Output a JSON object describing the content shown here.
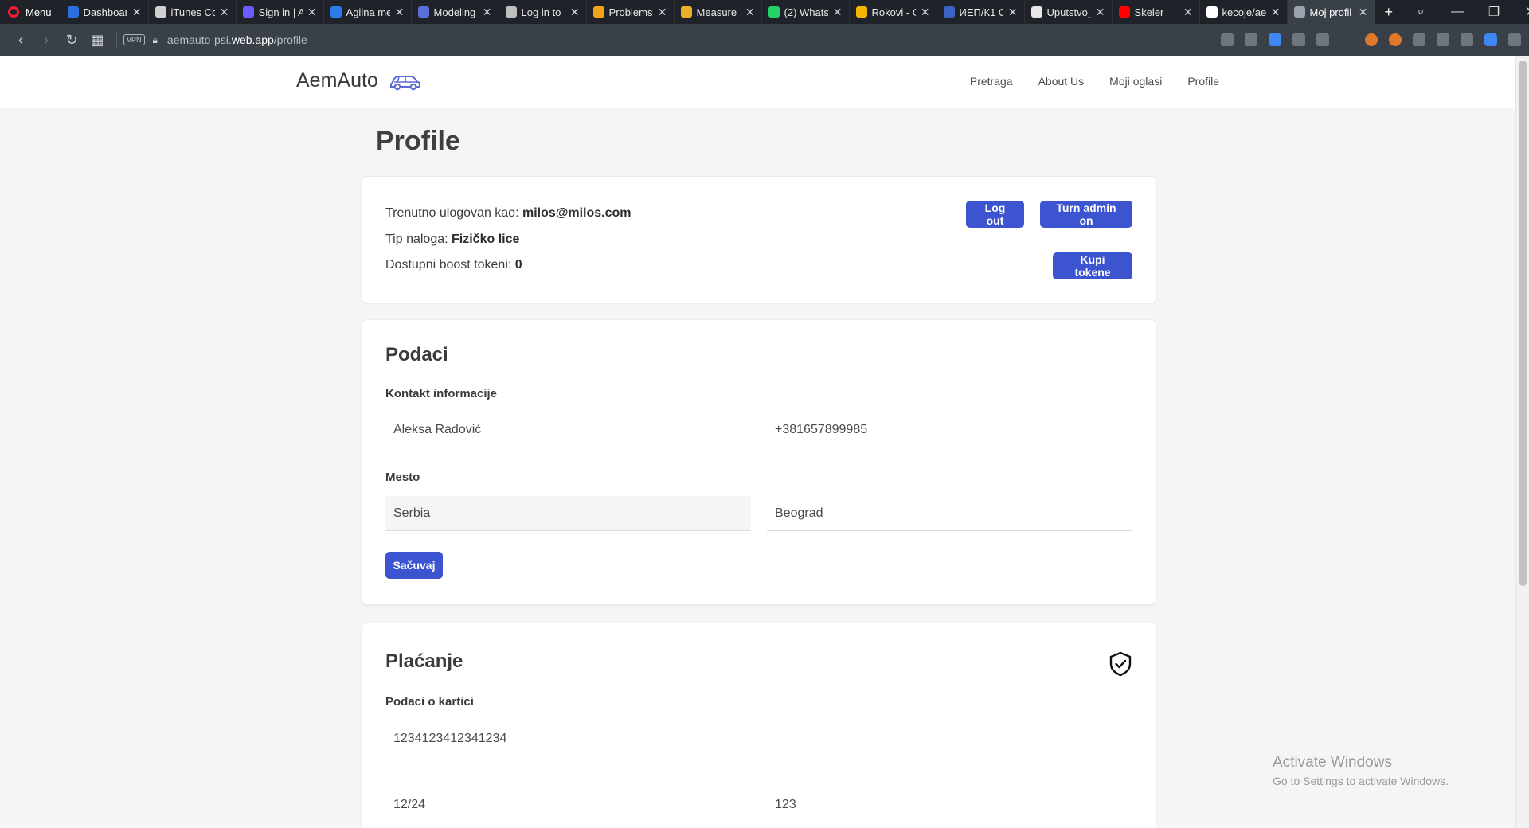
{
  "browser": {
    "menu_label": "Menu",
    "tabs": [
      {
        "title": "Dashboard",
        "color": "#2c6fe0"
      },
      {
        "title": "iTunes Co",
        "color": "#cfcfcf"
      },
      {
        "title": "Sign in | A",
        "color": "#6a5cff"
      },
      {
        "title": "Agilna me",
        "color": "#2b7de9"
      },
      {
        "title": "Modeling",
        "color": "#5b6fd6"
      },
      {
        "title": "Log in to",
        "color": "#bfbfbf"
      },
      {
        "title": "Problems",
        "color": "#f3a21a"
      },
      {
        "title": "Measure",
        "color": "#e9b026"
      },
      {
        "title": "(2) Whats",
        "color": "#25d366"
      },
      {
        "title": "Rokovi - G",
        "color": "#f5b400"
      },
      {
        "title": "ИЕП/К1 С",
        "color": "#3a62c7"
      },
      {
        "title": "Uputstvo_",
        "color": "#e8e8e8"
      },
      {
        "title": "Skeler",
        "color": "#ff0000"
      },
      {
        "title": "kecoje/ae",
        "color": "#ffffff"
      },
      {
        "title": "Moj profil",
        "color": "#9aa3ad"
      }
    ],
    "url_prefix": "aemauto-psi.",
    "url_domain": "web.app",
    "url_path": "/profile",
    "vpn_label": "VPN"
  },
  "navbar": {
    "brand": "AemAuto",
    "links": [
      "Pretraga",
      "About Us",
      "Moji oglasi",
      "Profile"
    ]
  },
  "page_title": "Profile",
  "account": {
    "logged_in_label": "Trenutno ulogovan kao: ",
    "email": "milos@milos.com",
    "account_type_label": "Tip naloga: ",
    "account_type": "Fizičko lice",
    "tokens_label": "Dostupni boost tokeni: ",
    "tokens": "0",
    "logout_button": "Log out",
    "admin_button": "Turn admin on",
    "buy_tokens_button": "Kupi tokene"
  },
  "podaci": {
    "title": "Podaci",
    "contact_label": "Kontakt informacije",
    "name": "Aleksa Radović",
    "phone": "+381657899985",
    "place_label": "Mesto",
    "country": "Serbia",
    "city": "Beograd",
    "save_button": "Sačuvaj"
  },
  "placanje": {
    "title": "Plaćanje",
    "card_label": "Podaci o kartici",
    "card_number": "1234123412341234",
    "expiry": "12/24",
    "cvv": "123"
  },
  "watermark": {
    "line1": "Activate Windows",
    "line2": "Go to Settings to activate Windows."
  },
  "colors": {
    "primary_button": "#3d54d1",
    "page_background": "#f5f5f5",
    "car_icon": "#5b6bd6"
  }
}
